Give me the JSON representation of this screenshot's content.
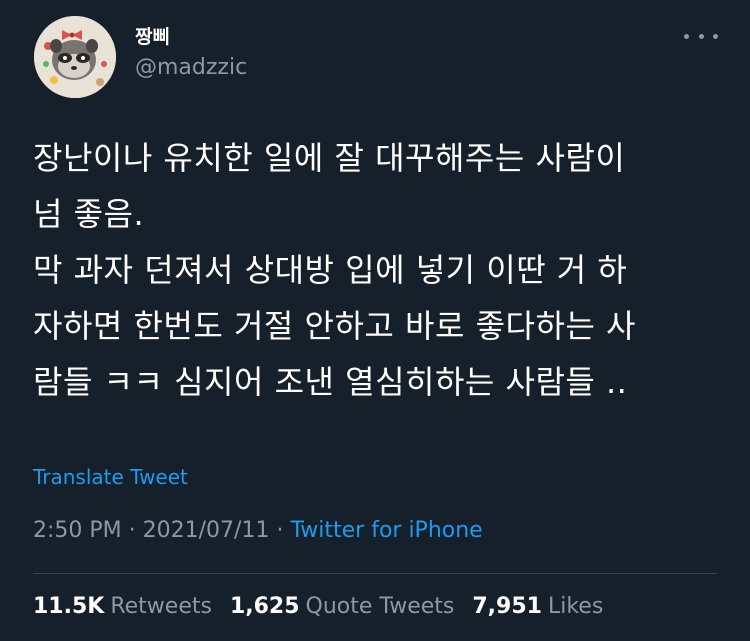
{
  "author": {
    "display_name": "짱삐",
    "handle": "@madzzic"
  },
  "tweet": {
    "text": "장난이나 유치한 일에 잘 대꾸해주는 사람이\n넘 좋음.\n막 과자 던져서 상대방 입에 넣기 이딴 거 하\n자하면 한번도 거절 안하고 바로 좋다하는 사\n람들 ㅋㅋ 심지어 조낸 열심히하는 사람들 ..",
    "translate_label": "Translate Tweet",
    "time": "2:50 PM",
    "date": "2021/07/11",
    "separator": "·",
    "source": "Twitter for iPhone"
  },
  "stats": {
    "retweets_count": "11.5K",
    "retweets_label": "Retweets",
    "quotes_count": "1,625",
    "quotes_label": "Quote Tweets",
    "likes_count": "7,951",
    "likes_label": "Likes"
  },
  "icons": {
    "more": "more-horizontal-icon"
  },
  "colors": {
    "background": "#15202b",
    "text": "#ffffff",
    "secondary": "#8b98a5",
    "link": "#1d9bf0",
    "divider": "#38444d"
  }
}
